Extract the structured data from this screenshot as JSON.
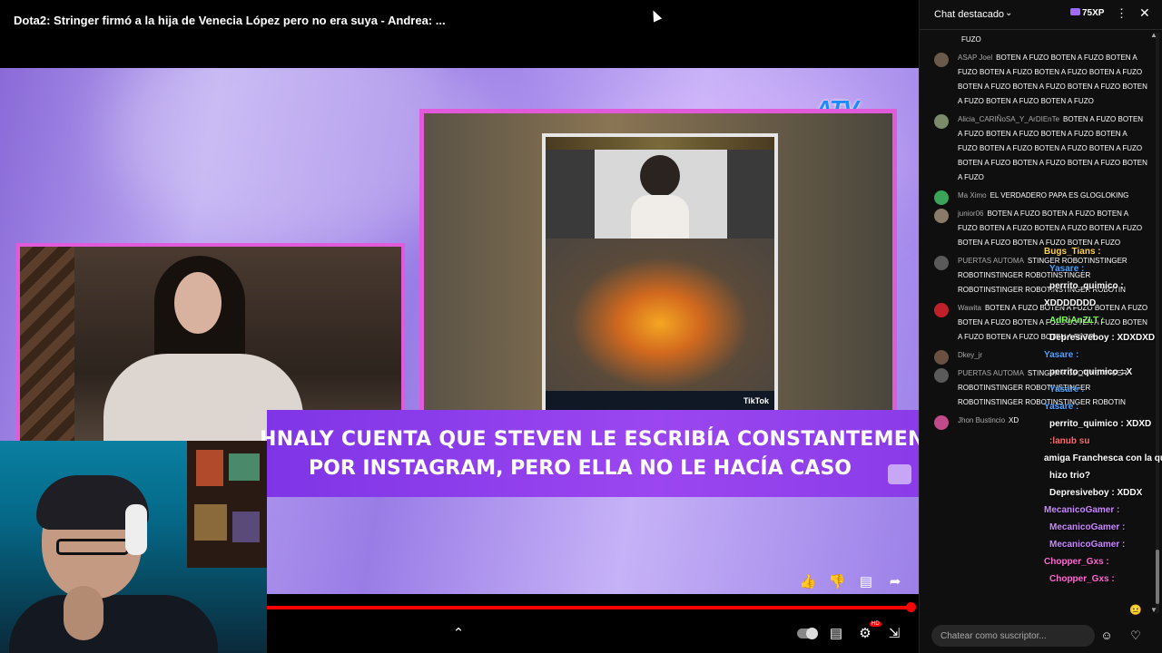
{
  "video": {
    "title": "Dota2:  Stringer firmó a la hija de Venecia López pero no era suya - Andrea: ...",
    "logo_text": "ATV",
    "banner_line1": "HNALY CUENTA QUE STEVEN LE ESCRIBÍA CONSTANTEMENTE",
    "banner_line2": "POR INSTAGRAM, PERO ELLA NO LE HACÍA CASO",
    "tiktok_label": "TikTok",
    "progress_fraction": 0.995
  },
  "chat": {
    "title": "Chat destacado",
    "xp_label": "75XP",
    "input_placeholder": "Chatear como suscriptor...",
    "messages": [
      {
        "author": "",
        "text": "FUZO",
        "avatar_color": "#444444"
      },
      {
        "author": "ASAP Joel",
        "text": "BOTEN A FUZO BOTEN A FUZO BOTEN A FUZO BOTEN A FUZO BOTEN A FUZO BOTEN A FUZO BOTEN A FUZO BOTEN A FUZO BOTEN A FUZO BOTEN A FUZO BOTEN A FUZO BOTEN A FUZO",
        "avatar_color": "#6a5a4a"
      },
      {
        "author": "Alicia_CARIÑoSA_Y_ArDIEnTe",
        "text": "BOTEN A FUZO BOTEN A FUZO BOTEN A FUZO BOTEN A FUZO BOTEN A FUZO BOTEN A FUZO BOTEN A FUZO BOTEN A FUZO BOTEN A FUZO BOTEN A FUZO BOTEN A FUZO BOTEN A FUZO",
        "avatar_color": "#7a8a6a"
      },
      {
        "author": "Ma Ximo",
        "text": "EL VERDADERO PAPA ES GLOGLOKING",
        "avatar_color": "#3aa55a"
      },
      {
        "author": "junior06",
        "text": "BOTEN A FUZO BOTEN A FUZO BOTEN A FUZO BOTEN A FUZO BOTEN A FUZO BOTEN A FUZO BOTEN A FUZO BOTEN A FUZO BOTEN A FUZO",
        "avatar_color": "#8a7a6a"
      },
      {
        "author": "PUERTAS AUTOMA",
        "text": "STINGER ROBOTINSTINGER ROBOTINSTINGER ROBOTINSTINGER ROBOTINSTINGER ROBOTINSTINGER ROBOTIN",
        "avatar_color": "#5a5a5a"
      },
      {
        "author": "Wawita",
        "text": "BOTEN A FUZO BOTEN A FUZO BOTEN A FUZO BOTEN A FUZO BOTEN A FUZO BOTEN A FUZO BOTEN A FUZO BOTEN A FUZO BOTEN A FUZO",
        "avatar_color": "#c0202a"
      },
      {
        "author": "Dkey_jr",
        "text": "",
        "avatar_color": "#6a5040"
      },
      {
        "author": "PUERTAS AUTOMA",
        "text": "STINGER ROBOTINSTINGER ROBOTINSTINGER ROBOTINSTINGER ROBOTINSTINGER ROBOTINSTINGER ROBOTIN",
        "avatar_color": "#5a5a5a"
      },
      {
        "author": "Jhon Bustincio",
        "text": "XD",
        "avatar_color": "#c04a8a"
      }
    ],
    "overlay": [
      {
        "name": "Bugs_Tians :",
        "color": "#ffd24a"
      },
      {
        "name": "Yasare :",
        "color": "#4aa3ff"
      },
      {
        "name": "perrito_quimico :",
        "color": "#ffffff"
      },
      {
        "name": "XDDDDDDD",
        "color": "#ffffff"
      },
      {
        "name": "AdRiAnZLT :",
        "color": "#7dff5a"
      },
      {
        "name": "Depresiveboy : XDXDXD",
        "color": "#ffffff"
      },
      {
        "name": "Yasare :",
        "color": "#4aa3ff"
      },
      {
        "name": "perrito_quimico : X",
        "color": "#ffffff"
      },
      {
        "name": "Yasare :",
        "color": "#4aa3ff"
      },
      {
        "name": "Yasare :",
        "color": "#4aa3ff"
      },
      {
        "name": "perrito_quimico : XDXD",
        "color": "#ffffff"
      },
      {
        "name": ":lanub su",
        "color": "#ff6a6a"
      },
      {
        "name": "amiga Franchesca con la que",
        "color": "#ffffff"
      },
      {
        "name": "hizo trio?",
        "color": "#ffffff"
      },
      {
        "name": "Depresiveboy : XDDX",
        "color": "#ffffff"
      },
      {
        "name": "MecanicoGamer :",
        "color": "#c98aff"
      },
      {
        "name": "MecanicoGamer :",
        "color": "#c98aff"
      },
      {
        "name": "MecanicoGamer :",
        "color": "#c98aff"
      },
      {
        "name": "Chopper_Gxs :",
        "color": "#ff6ad5"
      },
      {
        "name": "Chopper_Gxs :",
        "color": "#ff6ad5"
      }
    ]
  }
}
